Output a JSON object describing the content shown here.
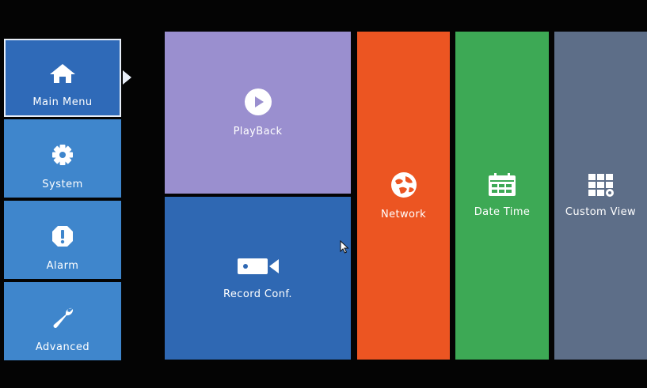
{
  "sidebar": {
    "items": [
      {
        "label": "Main Menu",
        "icon": "home-icon",
        "active": true
      },
      {
        "label": "System",
        "icon": "gear-icon",
        "active": false
      },
      {
        "label": "Alarm",
        "icon": "alert-icon",
        "active": false
      },
      {
        "label": "Advanced",
        "icon": "wrench-icon",
        "active": false
      }
    ]
  },
  "tiles": {
    "playback": {
      "label": "PlayBack",
      "icon": "play-icon",
      "color": "#9a8fcf"
    },
    "record": {
      "label": "Record Conf.",
      "icon": "camera-icon",
      "color": "#2f68b3"
    },
    "network": {
      "label": "Network",
      "icon": "network-icon",
      "color": "#ec5522"
    },
    "datetime": {
      "label": "Date Time",
      "icon": "calendar-icon",
      "color": "#3da955"
    },
    "custom": {
      "label": "Custom View",
      "icon": "grid-settings-icon",
      "color": "#5d6e88"
    }
  }
}
